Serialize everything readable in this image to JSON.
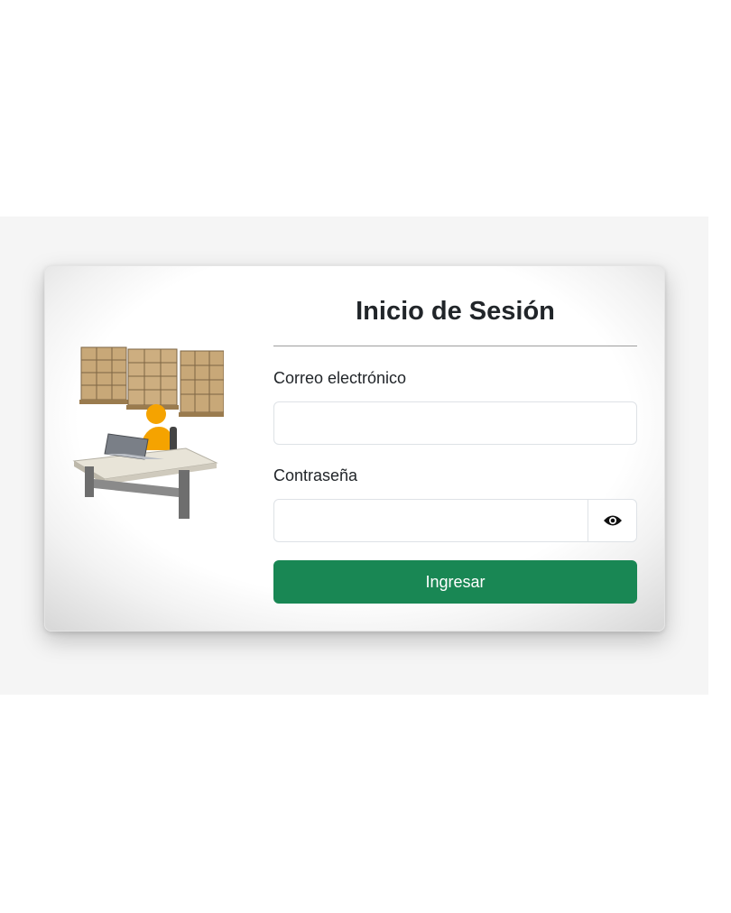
{
  "login": {
    "title": "Inicio de Sesión",
    "email_label": "Correo electrónico",
    "email_value": "",
    "password_label": "Contraseña",
    "password_value": "",
    "submit_label": "Ingresar"
  },
  "icons": {
    "illustration": "warehouse-worker-illustration",
    "toggle": "eye-icon"
  },
  "colors": {
    "primary_button": "#198754",
    "text": "#212529",
    "input_border": "#dee2e6"
  }
}
